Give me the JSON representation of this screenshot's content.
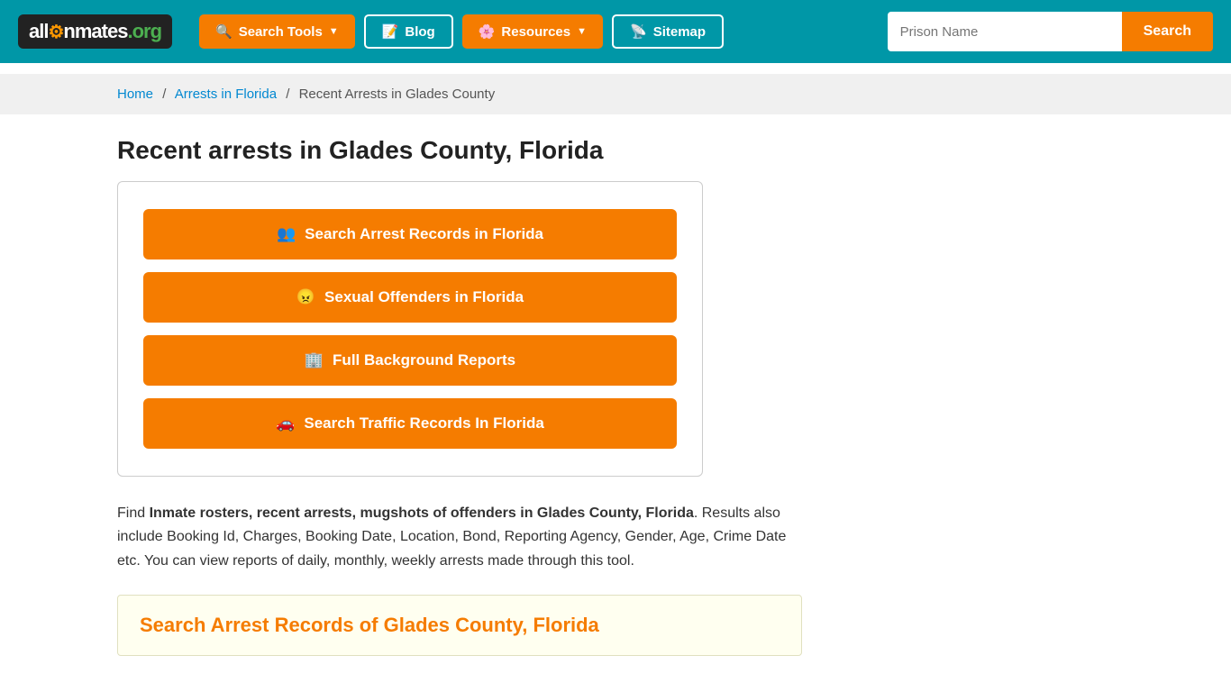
{
  "nav": {
    "logo": {
      "all": "all",
      "inmates": "Inmates",
      "org": ".org"
    },
    "search_tools_label": "Search Tools",
    "blog_label": "Blog",
    "resources_label": "Resources",
    "sitemap_label": "Sitemap",
    "prison_name_placeholder": "Prison Name",
    "search_btn_label": "Search"
  },
  "breadcrumb": {
    "home": "Home",
    "arrests_florida": "Arrests in Florida",
    "current": "Recent Arrests in Glades County"
  },
  "page": {
    "title": "Recent arrests in Glades County, Florida",
    "btn1": "Search Arrest Records in Florida",
    "btn2": "Sexual Offenders in Florida",
    "btn3": "Full Background Reports",
    "btn4": "Search Traffic Records In Florida",
    "desc_intro": "Find ",
    "desc_bold": "Inmate rosters, recent arrests, mugshots of offenders in Glades County, Florida",
    "desc_rest": ". Results also include Booking Id, Charges, Booking Date, Location, Bond, Reporting Agency, Gender, Age, Crime Date etc. You can view reports of daily, monthly, weekly arrests made through this tool.",
    "search_records_title": "Search Arrest Records of Glades County, Florida"
  },
  "icons": {
    "search_tools": "🔍",
    "blog": "📝",
    "resources": "🌸",
    "sitemap": "📡",
    "search_arrest": "👥",
    "sexual_offenders": "😠",
    "background": "🏢",
    "traffic": "🚗"
  }
}
